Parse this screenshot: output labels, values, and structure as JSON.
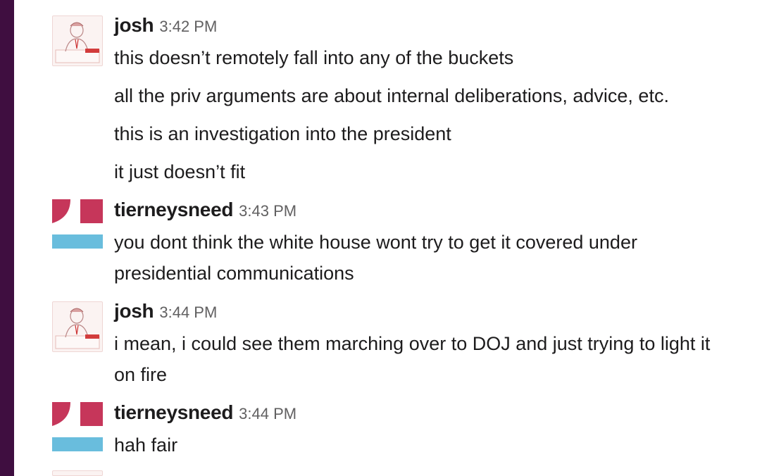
{
  "sidebar": {
    "color": "#3f0e40"
  },
  "colors": {
    "tierney_red": "#c6365a",
    "tierney_blue": "#69bddd"
  },
  "messages": [
    {
      "user": "josh",
      "avatar_icon": "josh-cartoon-avatar",
      "time": "3:42 PM",
      "lines": [
        "this doesn’t remotely fall into any of the buckets",
        "all the priv arguments are about internal deliberations, advice, etc.",
        "this is an investigation into the president",
        "it just doesn’t fit"
      ]
    },
    {
      "user": "tierneysneed",
      "avatar_icon": "tierneysneed-flag-avatar",
      "time": "3:43 PM",
      "lines": [
        "you dont think the white house wont try to get it covered under",
        "presidential communications"
      ]
    },
    {
      "user": "josh",
      "avatar_icon": "josh-cartoon-avatar",
      "time": "3:44 PM",
      "lines": [
        "i mean, i could see them marching over to DOJ and just trying to light it",
        "on fire"
      ]
    },
    {
      "user": "tierneysneed",
      "avatar_icon": "tierneysneed-flag-avatar",
      "time": "3:44 PM",
      "lines": [
        "hah fair"
      ]
    }
  ]
}
